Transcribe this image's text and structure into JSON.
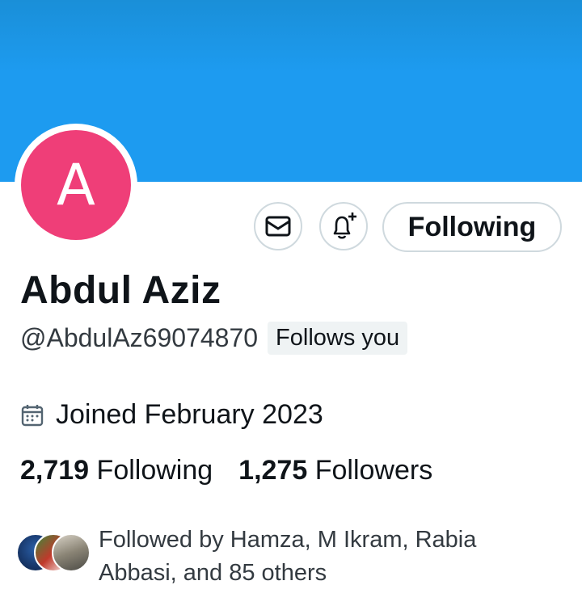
{
  "profile": {
    "avatar_letter": "A",
    "name": "Abdul Aziz",
    "handle": "@AbdulAz69074870",
    "follows_you": "Follows you",
    "joined": "Joined February 2023"
  },
  "actions": {
    "following_label": "Following"
  },
  "stats": {
    "following_count": "2,719",
    "following_label": "Following",
    "followers_count": "1,275",
    "followers_label": "Followers"
  },
  "followed_by": {
    "text": "Followed by Hamza, M Ikram, Rabia Abbasi, and 85 others"
  },
  "icons": {
    "message": "envelope-icon",
    "notify": "bell-plus-icon",
    "calendar": "calendar-icon"
  },
  "colors": {
    "banner": "#1d9bf0",
    "avatar_bg": "#ef3e78",
    "border": "#cfd9de"
  }
}
